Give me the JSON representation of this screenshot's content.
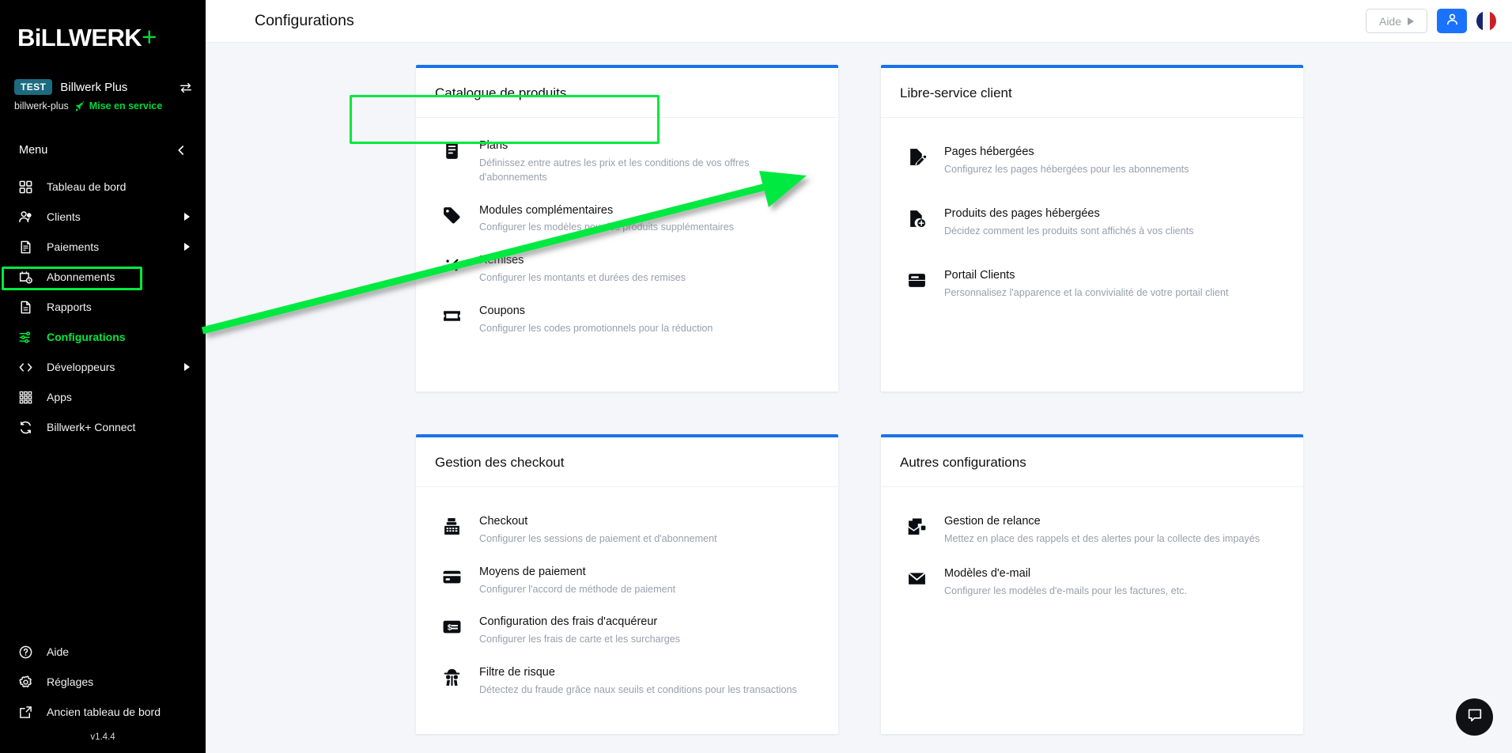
{
  "brand": {
    "name_main": "BiLLWERK",
    "name_plus": "+"
  },
  "tenant": {
    "badge": "TEST",
    "name": "Billwerk Plus",
    "slug": "billwerk-plus",
    "status": "Mise en service"
  },
  "sidebar": {
    "menu_label": "Menu",
    "version": "v1.4.4",
    "items": [
      {
        "label": "Tableau de bord",
        "icon": "grid-icon",
        "caret": false,
        "active": false
      },
      {
        "label": "Clients",
        "icon": "users-icon",
        "caret": true,
        "active": false
      },
      {
        "label": "Paiements",
        "icon": "invoice-icon",
        "caret": true,
        "active": false
      },
      {
        "label": "Abonnements",
        "icon": "calendar-clock-icon",
        "caret": false,
        "active": false
      },
      {
        "label": "Rapports",
        "icon": "document-icon",
        "caret": false,
        "active": false
      },
      {
        "label": "Configurations",
        "icon": "sliders-icon",
        "caret": false,
        "active": true
      },
      {
        "label": "Développeurs",
        "icon": "code-icon",
        "caret": true,
        "active": false
      },
      {
        "label": "Apps",
        "icon": "apps-icon",
        "caret": false,
        "active": false
      },
      {
        "label": "Billwerk+ Connect",
        "icon": "sync-icon",
        "caret": false,
        "active": false
      }
    ],
    "bottom_items": [
      {
        "label": "Aide",
        "icon": "help-circle-icon"
      },
      {
        "label": "Réglages",
        "icon": "gear-icon"
      },
      {
        "label": "Ancien tableau de bord",
        "icon": "external-link-icon"
      }
    ]
  },
  "header": {
    "title": "Configurations",
    "help_label": "Aide",
    "user_icon": "user-icon",
    "flag_icon": "flag-fr-icon"
  },
  "cards": [
    {
      "title": "Catalogue de produits",
      "rows": [
        {
          "title": "Plans",
          "sub": "Définissez entre autres les prix et les conditions de vos offres d'abonnements",
          "icon": "plan-document-icon",
          "highlighted": true
        },
        {
          "title": "Modules complémentaires",
          "sub": "Configurer les modèles pour les produits supplémentaires",
          "icon": "tag-icon",
          "highlighted": false
        },
        {
          "title": "Remises",
          "sub": "Configurer les montants et durées des remises",
          "icon": "percent-icon",
          "highlighted": false
        },
        {
          "title": "Coupons",
          "sub": "Configurer les codes promotionnels pour la réduction",
          "icon": "coupon-icon",
          "highlighted": false
        }
      ]
    },
    {
      "title": "Libre-service client",
      "rows": [
        {
          "title": "Pages hébergées",
          "sub": "Configurez les pages hébergées pour les abonnements",
          "icon": "page-edit-icon",
          "highlighted": false
        },
        {
          "title": "Produits des pages hébergées",
          "sub": "Décidez comment les produits sont affichés à vos clients",
          "icon": "page-add-icon",
          "highlighted": false
        },
        {
          "title": "Portail Clients",
          "sub": "Personnalisez l'apparence et la convivialité de votre portail client",
          "icon": "window-icon",
          "highlighted": false
        }
      ]
    },
    {
      "title": "Gestion des checkout",
      "rows": [
        {
          "title": "Checkout",
          "sub": "Configurer les sessions de paiement et d'abonnement",
          "icon": "cash-register-icon",
          "highlighted": false
        },
        {
          "title": "Moyens de paiement",
          "sub": "Configurer l'accord de méthode de paiement",
          "icon": "credit-card-icon",
          "highlighted": false
        },
        {
          "title": "Configuration des frais d'acquéreur",
          "sub": "Configurer les frais de carte et les surcharges",
          "icon": "card-fee-icon",
          "highlighted": false
        },
        {
          "title": "Filtre de risque",
          "sub": "Détectez du fraude grâce naux seuils et conditions pour les transactions",
          "icon": "spy-icon",
          "highlighted": false
        }
      ]
    },
    {
      "title": "Autres configurations",
      "rows": [
        {
          "title": "Gestion de relance",
          "sub": "Mettez en place des rappels et des alertes pour la collecte des impayés",
          "icon": "dunning-mail-icon",
          "highlighted": false
        },
        {
          "title": "Modèles d'e-mail",
          "sub": "Configurer les modèles d'e-mails pour les factures, etc.",
          "icon": "envelope-icon",
          "highlighted": false
        }
      ]
    }
  ],
  "chat": {
    "icon": "chat-bubble-icon"
  },
  "annotations": {
    "arrow_color": "#00e93f",
    "highlight_color": "#00e93f"
  },
  "colors": {
    "accent_blue": "#1a73e8",
    "brand_green": "#00d83c",
    "sidebar_bg": "#000000",
    "page_bg": "#f4f6f9"
  }
}
